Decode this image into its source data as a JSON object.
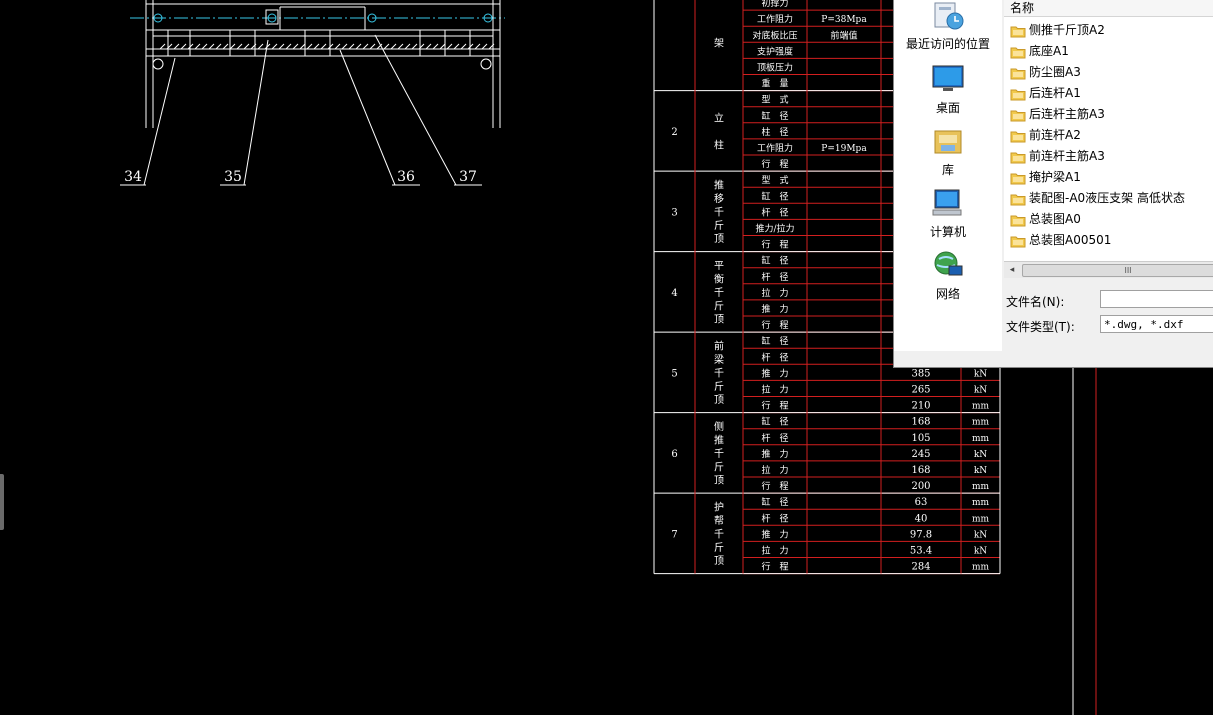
{
  "drawing": {
    "balloons": [
      "34",
      "35",
      "36",
      "37"
    ],
    "rows": [
      {
        "no": "",
        "label": [
          "架"
        ],
        "params": [
          "初撑力",
          "工作阻力",
          "对底板比压",
          "支护强度",
          "顶板压力",
          "重　量"
        ],
        "vals": [
          "",
          "",
          "",
          "",
          "",
          ""
        ],
        "units": [
          "",
          "",
          "",
          "",
          "",
          ""
        ],
        "notes": [
          "",
          "P=38Mpa",
          "前端值",
          "",
          "",
          ""
        ]
      },
      {
        "no": "2",
        "label": [
          "立",
          "柱"
        ],
        "params": [
          "型　式",
          "缸　径",
          "柱　径",
          "工作阻力",
          "行　程"
        ],
        "vals": [
          "",
          "",
          "",
          "",
          ""
        ],
        "units": [
          "",
          "",
          "",
          "",
          ""
        ],
        "notes": [
          "",
          "",
          "",
          "P=19Mpa",
          ""
        ]
      },
      {
        "no": "3",
        "label": [
          "推",
          "移",
          "千",
          "斤",
          "顶"
        ],
        "params": [
          "型　式",
          "缸　径",
          "杆　径",
          "推力/拉力",
          "行　程"
        ],
        "vals": [
          "",
          "",
          "",
          "",
          ""
        ],
        "units": [
          "",
          "",
          "",
          "",
          ""
        ],
        "notes": [
          "",
          "",
          "",
          "",
          ""
        ]
      },
      {
        "no": "4",
        "label": [
          "平",
          "衡",
          "千",
          "斤",
          "顶"
        ],
        "params": [
          "缸　径",
          "杆　径",
          "拉　力",
          "推　力",
          "行　程"
        ],
        "vals": [
          "",
          "",
          "",
          "",
          ""
        ],
        "units": [
          "",
          "",
          "",
          "",
          ""
        ],
        "notes": [
          "",
          "",
          "",
          "",
          ""
        ]
      },
      {
        "no": "5",
        "label": [
          "前",
          "梁",
          "千",
          "斤",
          "顶"
        ],
        "params": [
          "缸　径",
          "杆　径",
          "推　力",
          "拉　力",
          "行　程"
        ],
        "vals": [
          "",
          "",
          "385",
          "265",
          "210"
        ],
        "units": [
          "",
          "",
          "kN",
          "kN",
          "mm"
        ],
        "notes": [
          "",
          "",
          "",
          "",
          ""
        ]
      },
      {
        "no": "6",
        "label": [
          "侧",
          "推",
          "千",
          "斤",
          "顶"
        ],
        "params": [
          "缸　径",
          "杆　径",
          "推　力",
          "拉　力",
          "行　程"
        ],
        "vals": [
          "168",
          "105",
          "245",
          "168",
          "200"
        ],
        "units": [
          "mm",
          "mm",
          "kN",
          "kN",
          "mm"
        ],
        "notes": [
          "",
          "",
          "",
          "",
          ""
        ]
      },
      {
        "no": "7",
        "label": [
          "护",
          "帮",
          "千",
          "斤",
          "顶"
        ],
        "params": [
          "缸　径",
          "杆　径",
          "推　力",
          "拉　力",
          "行　程"
        ],
        "vals": [
          "63",
          "40",
          "97.8",
          "53.4",
          "284"
        ],
        "units": [
          "mm",
          "mm",
          "kN",
          "kN",
          "mm"
        ],
        "notes": [
          "",
          "",
          "",
          "",
          ""
        ]
      }
    ]
  },
  "dialog": {
    "places": [
      {
        "label": "最近访问的位置",
        "icon": "recent-places-icon"
      },
      {
        "label": "桌面",
        "icon": "desktop-icon"
      },
      {
        "label": "库",
        "icon": "libraries-icon"
      },
      {
        "label": "计算机",
        "icon": "computer-icon"
      },
      {
        "label": "网络",
        "icon": "network-icon"
      }
    ],
    "column_name": "名称",
    "files": [
      "侧推千斤顶A2",
      "底座A1",
      "防尘圈A3",
      "后连杆A1",
      "后连杆主筋A3",
      "前连杆A2",
      "前连杆主筋A3",
      "掩护梁A1",
      "装配图-A0液压支架 高低状态",
      "总装图A0",
      "总装图A00501"
    ],
    "filename_label": "文件名(N):",
    "filename_value": "",
    "filetype_label": "文件类型(T):",
    "filetype_value": "*.dwg, *.dxf",
    "scroll_left": "◂",
    "scroll_grip": "III"
  }
}
